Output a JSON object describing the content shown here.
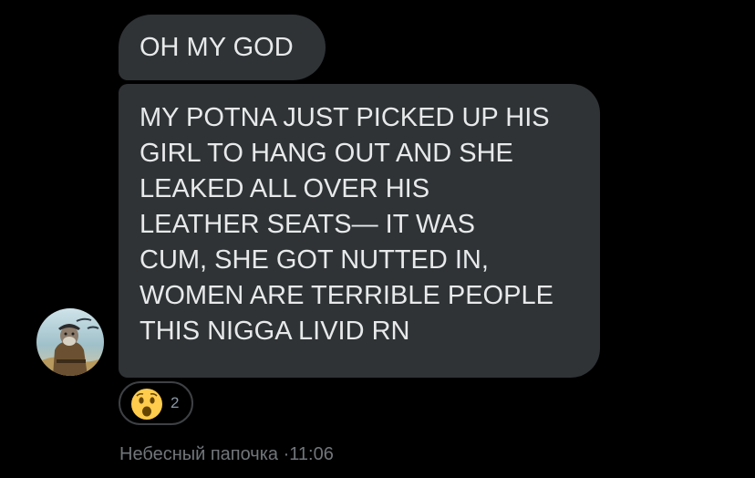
{
  "messages": [
    {
      "lines": [
        "OH MY GOD"
      ]
    },
    {
      "lines": [
        "MY POTNA JUST PICKED UP HIS",
        "GIRL TO HANG OUT AND SHE",
        "LEAKED ALL OVER HIS",
        "LEATHER SEATS— IT WAS",
        "CUM, SHE GOT NUTTED IN,",
        "WOMEN ARE TERRIBLE PEOPLE",
        "THIS NIGGA LIVID RN"
      ]
    }
  ],
  "reaction": {
    "icon": "surprised-face-icon",
    "count": "2"
  },
  "sender": {
    "name": "Небесный папочка",
    "separator": "·",
    "time": "11:06"
  },
  "colors": {
    "background": "#000000",
    "bubble": "#2f3336",
    "text": "#e7e9ea",
    "meta": "#71767b"
  }
}
